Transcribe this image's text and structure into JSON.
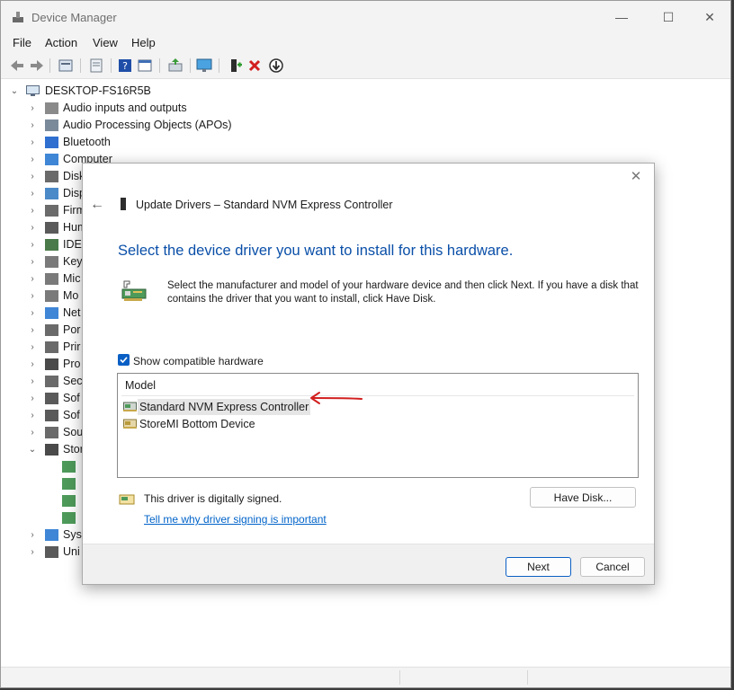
{
  "window": {
    "title": "Device Manager",
    "controls": {
      "minimize": "—",
      "maximize": "☐",
      "close": "✕"
    }
  },
  "menu": {
    "items": [
      "File",
      "Action",
      "View",
      "Help"
    ]
  },
  "toolbar": {
    "icons": [
      "back-arrow-icon",
      "forward-arrow-icon",
      "properties-icon",
      "help-icon",
      "view-icon",
      "update-driver-icon",
      "monitor-icon",
      "add-driver-icon",
      "uninstall-icon",
      "download-icon"
    ]
  },
  "tree": {
    "root": "DESKTOP-FS16R5B",
    "items": [
      {
        "label": "Audio inputs and outputs"
      },
      {
        "label": "Audio Processing Objects (APOs)"
      },
      {
        "label": "Bluetooth"
      },
      {
        "label": "Computer"
      },
      {
        "label": "Disk"
      },
      {
        "label": "Disp"
      },
      {
        "label": "Firm"
      },
      {
        "label": "Hum"
      },
      {
        "label": "IDE"
      },
      {
        "label": "Key"
      },
      {
        "label": "Mic"
      },
      {
        "label": "Mo"
      },
      {
        "label": "Net"
      },
      {
        "label": "Por"
      },
      {
        "label": "Prir"
      },
      {
        "label": "Pro"
      },
      {
        "label": "Sec"
      },
      {
        "label": "Sof"
      },
      {
        "label": "Sof"
      },
      {
        "label": "Sou"
      },
      {
        "label": "Stor"
      },
      {
        "label": ""
      },
      {
        "label": ""
      },
      {
        "label": ""
      },
      {
        "label": ""
      },
      {
        "label": "Syst"
      },
      {
        "label": "Uni"
      }
    ]
  },
  "dialog": {
    "close": "✕",
    "back": "←",
    "header_title": "Update Drivers – Standard NVM Express Controller",
    "heading": "Select the device driver you want to install for this hardware.",
    "instructions": "Select the manufacturer and model of your hardware device and then click Next. If you have a disk that contains the driver that you want to install, click Have Disk.",
    "show_compatible_label": "Show compatible hardware",
    "show_compatible_checked": true,
    "list_header": "Model",
    "models": [
      {
        "label": "Standard NVM Express Controller",
        "selected": true
      },
      {
        "label": "StoreMI Bottom Device",
        "selected": false
      }
    ],
    "signed_text": "This driver is digitally signed.",
    "signing_link": "Tell me why driver signing is important",
    "have_disk": "Have Disk...",
    "next": "Next",
    "cancel": "Cancel"
  },
  "colors": {
    "accent": "#0a5fc4",
    "heading": "#0a4fa8",
    "link": "#0063c9",
    "annotation_arrow": "#d21f1f"
  }
}
